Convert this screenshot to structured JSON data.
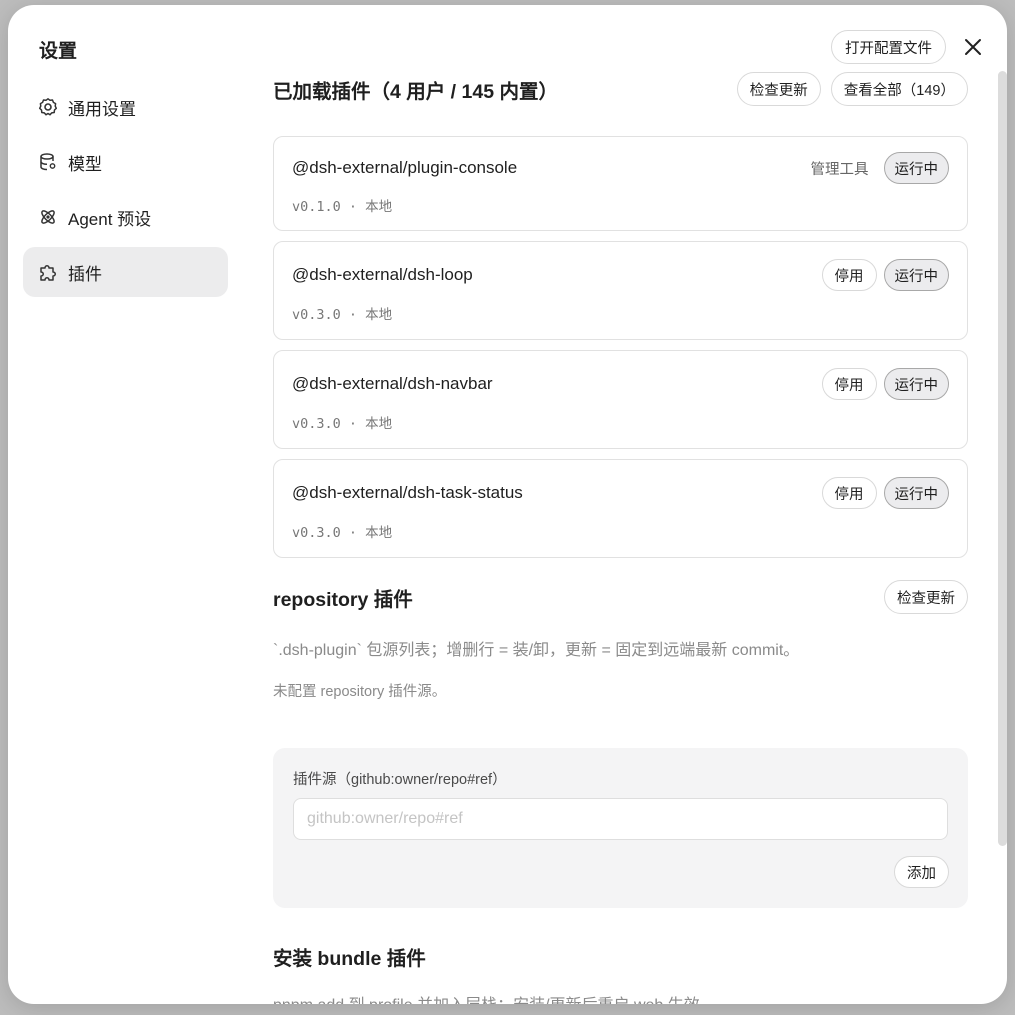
{
  "dialog": {
    "title": "设置",
    "open_config_label": "打开配置文件"
  },
  "sidebar": {
    "items": [
      {
        "label": "通用设置",
        "icon": "gear-icon"
      },
      {
        "label": "模型",
        "icon": "database-icon"
      },
      {
        "label": "Agent 预设",
        "icon": "atom-icon"
      },
      {
        "label": "插件",
        "icon": "puzzle-icon",
        "active": true
      }
    ]
  },
  "loaded": {
    "title": "已加载插件（4 用户 / 145 内置）",
    "check_update_label": "检查更新",
    "view_all_label": "查看全部（149）",
    "plugins": [
      {
        "name": "@dsh-external/plugin-console",
        "meta": "v0.1.0 · 本地",
        "manage_label": "管理工具",
        "status": "运行中"
      },
      {
        "name": "@dsh-external/dsh-loop",
        "meta": "v0.3.0 · 本地",
        "disable_label": "停用",
        "status": "运行中"
      },
      {
        "name": "@dsh-external/dsh-navbar",
        "meta": "v0.3.0 · 本地",
        "disable_label": "停用",
        "status": "运行中"
      },
      {
        "name": "@dsh-external/dsh-task-status",
        "meta": "v0.3.0 · 本地",
        "disable_label": "停用",
        "status": "运行中"
      }
    ]
  },
  "repository": {
    "title": "repository 插件",
    "check_update_label": "检查更新",
    "description": "`.dsh-plugin` 包源列表；增删行 = 装/卸，更新 = 固定到远端最新 commit。",
    "empty_text": "未配置 repository 插件源。",
    "add_label": "插件源（github:owner/repo#ref）",
    "input_placeholder": "github:owner/repo#ref",
    "input_value": "",
    "add_button_label": "添加"
  },
  "bundle": {
    "title": "安装 bundle 插件",
    "description": "pnpm add 到 profile 并加入层栈；安装/更新后重启 web 生效。"
  }
}
